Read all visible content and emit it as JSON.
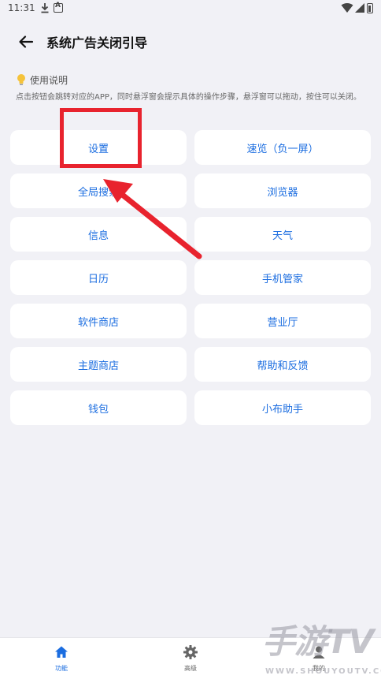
{
  "status_bar": {
    "time": "11:31"
  },
  "header": {
    "title": "系统广告关闭引导"
  },
  "help": {
    "title": "使用说明",
    "description": "点击按钮会跳转对应的APP，同时悬浮窗会提示具体的操作步骤，悬浮窗可以拖动，按住可以关闭。"
  },
  "buttons": [
    {
      "label": "设置"
    },
    {
      "label": "速览（负一屏）"
    },
    {
      "label": "全局搜索"
    },
    {
      "label": "浏览器"
    },
    {
      "label": "信息"
    },
    {
      "label": "天气"
    },
    {
      "label": "日历"
    },
    {
      "label": "手机管家"
    },
    {
      "label": "软件商店"
    },
    {
      "label": "营业厅"
    },
    {
      "label": "主题商店"
    },
    {
      "label": "帮助和反馈"
    },
    {
      "label": "钱包"
    },
    {
      "label": "小布助手"
    }
  ],
  "tabs": [
    {
      "label": "功能",
      "icon": "home-icon",
      "active": true
    },
    {
      "label": "高级",
      "icon": "gear-icon",
      "active": false
    },
    {
      "label": "我的",
      "icon": "person-icon",
      "active": false
    }
  ],
  "watermark": {
    "main": "手游TV",
    "sub": "WWW.SHOUYOUTV.COM"
  },
  "colors": {
    "accent": "#1b6de0",
    "highlight": "#e8232e",
    "background": "#f1f1f6"
  }
}
